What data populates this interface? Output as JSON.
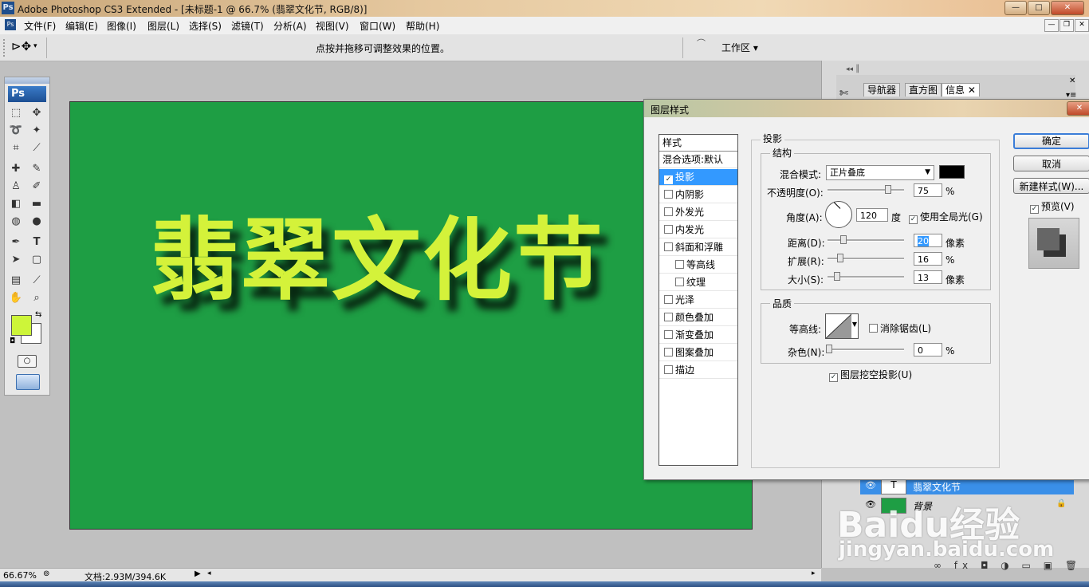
{
  "window": {
    "app_icon": "Ps",
    "title": "Adobe Photoshop CS3 Extended - [未标题-1 @ 66.7% (翡翠文化节, RGB/8)]",
    "minimize": "—",
    "maximize": "□",
    "close": "✕"
  },
  "menu": [
    "文件(F)",
    "编辑(E)",
    "图像(I)",
    "图层(L)",
    "选择(S)",
    "滤镜(T)",
    "分析(A)",
    "视图(V)",
    "窗口(W)",
    "帮助(H)"
  ],
  "doc_controls": {
    "min": "—",
    "restore": "❐",
    "close": "✕"
  },
  "options_bar": {
    "hint": "点按并拖移可调整效果的位置。",
    "workspace": "工作区 ▾"
  },
  "toolbox": {
    "logo": "Ps"
  },
  "canvas": {
    "text": "翡翠文化节",
    "bg_color": "#1e9e44",
    "text_color": "#d4f23a"
  },
  "panels": {
    "tabs": [
      "导航器",
      "直方图",
      "信息"
    ],
    "layers": [
      {
        "name": "翡翠文化节",
        "thumb": "T",
        "selected": true
      },
      {
        "name": "背景",
        "thumb": "",
        "selected": false
      }
    ],
    "footer_icons": "∞ fx ◘ ◑ ▭ ▣ 🗑"
  },
  "watermark": {
    "brand": "Baidu经验",
    "url": "jingyan.baidu.com"
  },
  "status": {
    "zoom": "66.67%",
    "doc": "文档:2.93M/394.6K"
  },
  "dialog": {
    "title": "图层样式",
    "styles_header": "样式",
    "styles": [
      {
        "label": "混合选项:默认",
        "checkbox": false,
        "checked": false,
        "indent": false,
        "active": false
      },
      {
        "label": "投影",
        "checkbox": true,
        "checked": true,
        "indent": false,
        "active": true
      },
      {
        "label": "内阴影",
        "checkbox": true,
        "checked": false,
        "indent": false,
        "active": false
      },
      {
        "label": "外发光",
        "checkbox": true,
        "checked": false,
        "indent": false,
        "active": false
      },
      {
        "label": "内发光",
        "checkbox": true,
        "checked": false,
        "indent": false,
        "active": false
      },
      {
        "label": "斜面和浮雕",
        "checkbox": true,
        "checked": false,
        "indent": false,
        "active": false
      },
      {
        "label": "等高线",
        "checkbox": true,
        "checked": false,
        "indent": true,
        "active": false
      },
      {
        "label": "纹理",
        "checkbox": true,
        "checked": false,
        "indent": true,
        "active": false
      },
      {
        "label": "光泽",
        "checkbox": true,
        "checked": false,
        "indent": false,
        "active": false
      },
      {
        "label": "颜色叠加",
        "checkbox": true,
        "checked": false,
        "indent": false,
        "active": false
      },
      {
        "label": "渐变叠加",
        "checkbox": true,
        "checked": false,
        "indent": false,
        "active": false
      },
      {
        "label": "图案叠加",
        "checkbox": true,
        "checked": false,
        "indent": false,
        "active": false
      },
      {
        "label": "描边",
        "checkbox": true,
        "checked": false,
        "indent": false,
        "active": false
      }
    ],
    "section": "投影",
    "structure": {
      "title": "结构",
      "blend_label": "混合模式:",
      "blend_value": "正片叠底",
      "shadow_color": "#000000",
      "opacity_label": "不透明度(O):",
      "opacity_value": "75",
      "opacity_unit": "%",
      "angle_label": "角度(A):",
      "angle_value": "120",
      "angle_unit": "度",
      "global_light_label": "使用全局光(G)",
      "distance_label": "距离(D):",
      "distance_value": "20",
      "distance_unit": "像素",
      "spread_label": "扩展(R):",
      "spread_value": "16",
      "spread_unit": "%",
      "size_label": "大小(S):",
      "size_value": "13",
      "size_unit": "像素"
    },
    "quality": {
      "title": "品质",
      "contour_label": "等高线:",
      "antialias_label": "消除锯齿(L)",
      "noise_label": "杂色(N):",
      "noise_value": "0",
      "noise_unit": "%"
    },
    "knockout_label": "图层挖空投影(U)",
    "buttons": {
      "ok": "确定",
      "cancel": "取消",
      "new_style": "新建样式(W)...",
      "preview": "预览(V)"
    }
  }
}
